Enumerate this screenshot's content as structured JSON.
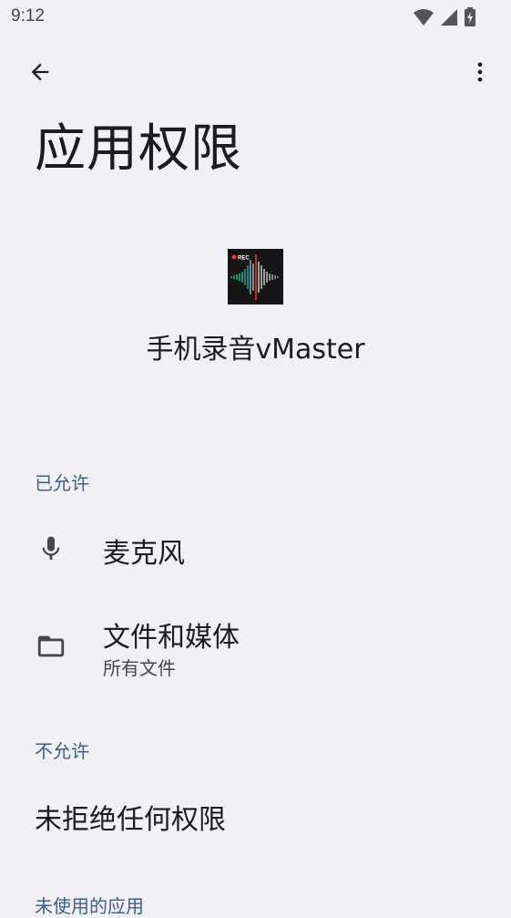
{
  "status_bar": {
    "time": "9:12",
    "icons": [
      "wifi-icon",
      "cell-signal-icon",
      "battery-charging-icon"
    ]
  },
  "toolbar": {
    "back_icon": "arrow-back-icon",
    "more_icon": "more-vert-icon"
  },
  "page": {
    "title": "应用权限"
  },
  "app": {
    "name": "手机录音vMaster",
    "icon": "app-icon-waveform",
    "icon_badge": "REC"
  },
  "sections": {
    "allowed": {
      "header": "已允许",
      "items": [
        {
          "title": "麦克风",
          "subtitle": "",
          "icon": "microphone-icon"
        },
        {
          "title": "文件和媒体",
          "subtitle": "所有文件",
          "icon": "folder-icon"
        }
      ]
    },
    "denied": {
      "header": "不允许",
      "empty_text": "未拒绝任何权限"
    },
    "unused": {
      "header": "未使用的应用"
    }
  },
  "colors": {
    "background": "#f1f0f4",
    "section_header": "#3a5f90",
    "text_primary": "#1c1b1f",
    "text_secondary": "#46464f"
  }
}
